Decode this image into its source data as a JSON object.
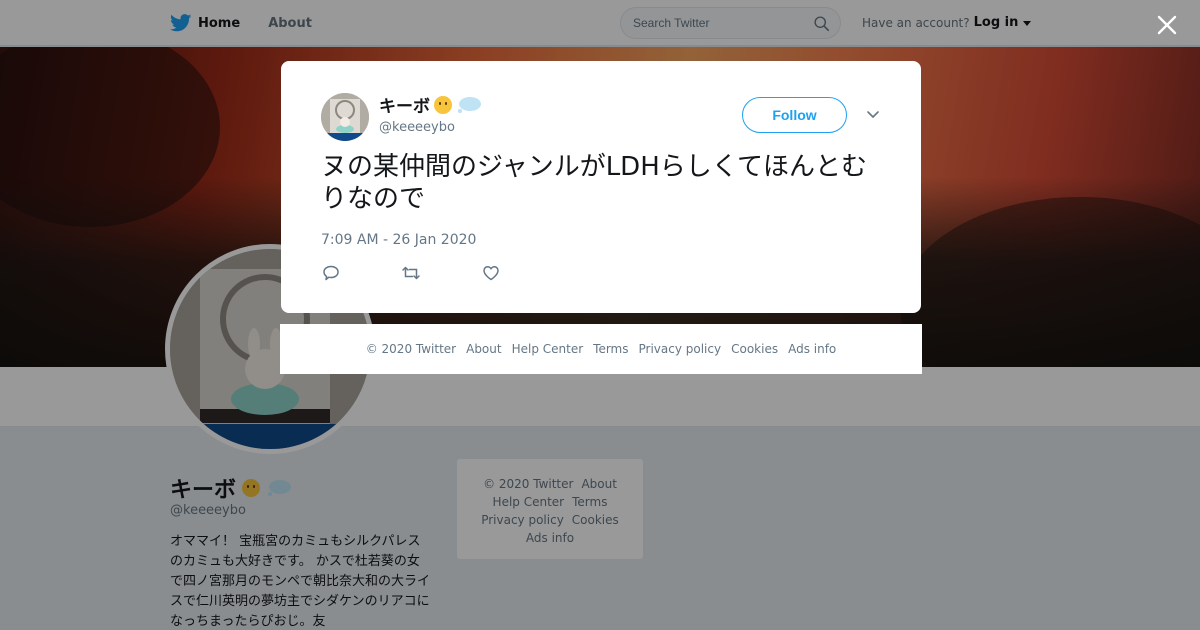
{
  "nav": {
    "home_label": "Home",
    "about_label": "About",
    "search_placeholder": "Search Twitter",
    "account_prompt": "Have an account?",
    "login_label": "Log in"
  },
  "profile": {
    "name": "キーボ",
    "handle": "@keeeeybo",
    "bio": "オママイ！ 宝瓶宮のカミュもシルクパレスのカミュも大好きです。 かスで杜若葵の女で四ノ宮那月のモンペで朝比奈大和の大ライスで仁川英明の夢坊主でシダケンのリアコになっちまったらぴおじ。友"
  },
  "sidebar_footer": {
    "copyright": "© 2020 Twitter",
    "about": "About",
    "help": "Help Center",
    "terms": "Terms",
    "privacy": "Privacy policy",
    "cookies": "Cookies",
    "ads": "Ads info"
  },
  "tweet": {
    "author_name": "キーボ",
    "author_handle": "@keeeeybo",
    "follow_label": "Follow",
    "text": "ヌの某仲間のジャンルがLDHらしくてほんとむりなので",
    "timestamp": "7:09 AM - 26 Jan 2020"
  },
  "modal_footer": {
    "copyright": "© 2020 Twitter",
    "about": "About",
    "help": "Help Center",
    "terms": "Terms",
    "privacy": "Privacy policy",
    "cookies": "Cookies",
    "ads": "Ads info"
  },
  "icons": {
    "brand": "twitter-bird-icon",
    "search": "search-icon",
    "close": "close-icon",
    "chevron": "chevron-down-icon",
    "reply": "reply-icon",
    "retweet": "retweet-icon",
    "like": "heart-icon"
  },
  "colors": {
    "brand_blue": "#1da1f2",
    "text_primary": "#14171a",
    "text_secondary": "#657786"
  }
}
